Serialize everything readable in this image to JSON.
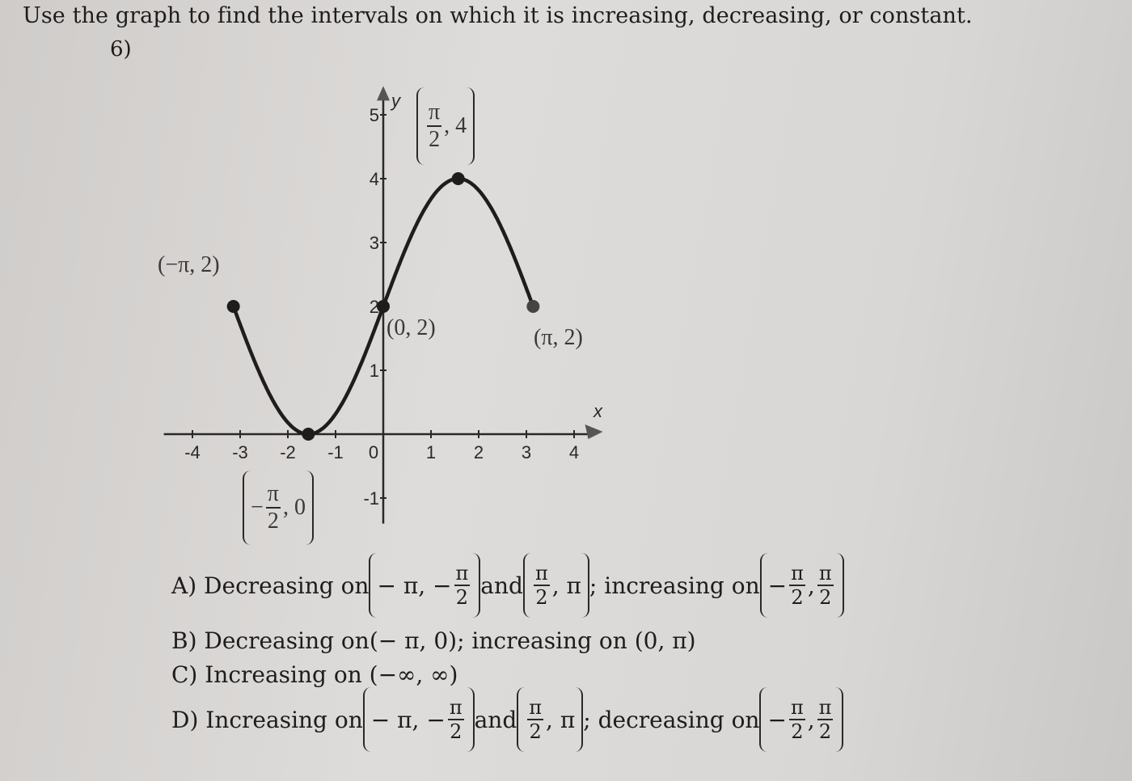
{
  "question": {
    "title": "Use the graph to find the intervals on which it is increasing, decreasing, or constant.",
    "number": "6)"
  },
  "chart_data": {
    "type": "line",
    "function_shape": "y = 2 + 2 sin x",
    "x_domain": [
      -3.14159,
      3.14159
    ],
    "xlim": [
      -4.6,
      4.5
    ],
    "ylim": [
      -1.4,
      5.4
    ],
    "xlabel": "x",
    "ylabel": "y",
    "x_ticks": [
      "-4",
      "-3",
      "-2",
      "-1",
      "0",
      "1",
      "2",
      "3",
      "4"
    ],
    "y_ticks": [
      "-1",
      "1",
      "2",
      "3",
      "4",
      "5"
    ],
    "grid": false,
    "points": [
      {
        "x": -3.14159,
        "y": 2,
        "label": "(−π, 2)"
      },
      {
        "x": -1.5708,
        "y": 0,
        "label_pre": "−",
        "label_num": "π",
        "label_den": "2",
        "label_post": ", 0"
      },
      {
        "x": 0,
        "y": 2,
        "label": "(0, 2)"
      },
      {
        "x": 1.5708,
        "y": 4,
        "label_num": "π",
        "label_den": "2",
        "label_post": ", 4"
      },
      {
        "x": 3.14159,
        "y": 2,
        "label": "(π, 2)"
      }
    ]
  },
  "options": {
    "a": {
      "label": "A) Decreasing on",
      "i1": "− π, −",
      "and": "and",
      "i2post": ", π",
      "mid": "; increasing on",
      "neg": "−",
      "comma": ",",
      "pi": "π",
      "two": "2"
    },
    "b": {
      "text": "B) Decreasing on",
      "i1": "(− π, 0)",
      "mid": "; increasing on",
      "i2": "(0, π)"
    },
    "c": {
      "text": "C) Increasing on (−∞, ∞)"
    },
    "d": {
      "label": "D) Increasing on",
      "i1": "− π, −",
      "and": "and",
      "i2post": ", π",
      "mid": "; decreasing on",
      "neg": "−",
      "comma": ",",
      "pi": "π",
      "two": "2"
    }
  },
  "colors": {
    "ink": "#1e1c1c",
    "paper": "#d8d6d4"
  }
}
